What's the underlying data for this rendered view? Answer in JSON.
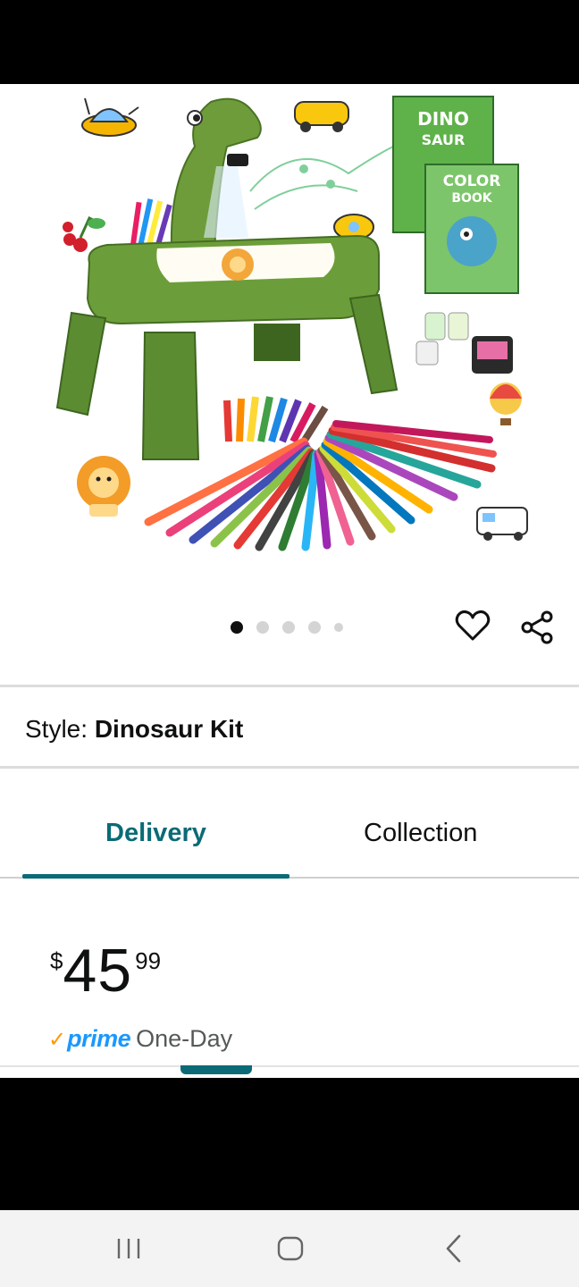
{
  "product": {
    "style_label": "Style:",
    "style_value": "Dinosaur Kit",
    "image_alt": "Dinosaur projector drawing table with pens, crayons, stamps and colouring books",
    "book_text_1": "DINO",
    "book_text_2": "SAUR",
    "book_text_3": "COLOR",
    "book_text_4": "BOOK"
  },
  "carousel": {
    "total": 5,
    "active_index": 0
  },
  "tabs": [
    {
      "label": "Delivery",
      "selected": true
    },
    {
      "label": "Collection",
      "selected": false
    }
  ],
  "price": {
    "symbol": "$",
    "whole": "45",
    "fraction": "99"
  },
  "shipping": {
    "check": "✓",
    "prime": "prime",
    "speed": "One-Day"
  },
  "icons": {
    "wishlist": "heart-icon",
    "share": "share-icon",
    "nav_recents": "recents-icon",
    "nav_home": "home-icon",
    "nav_back": "back-icon"
  },
  "colors": {
    "accent_teal": "#0a6b76",
    "prime_blue": "#1a98ff",
    "prime_check": "#ff9900",
    "table_green": "#6b9e3a"
  }
}
